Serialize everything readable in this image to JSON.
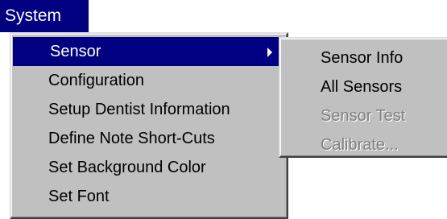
{
  "menubar": {
    "system_label": "System"
  },
  "main_menu": {
    "items": [
      {
        "label": "Sensor",
        "state": "selected",
        "has_submenu": true
      },
      {
        "label": "Configuration",
        "state": "enabled"
      },
      {
        "label": "Setup Dentist Information",
        "state": "enabled"
      },
      {
        "label": "Define Note Short-Cuts",
        "state": "enabled"
      },
      {
        "label": "Set Background Color",
        "state": "enabled"
      },
      {
        "label": "Set Font",
        "state": "enabled"
      }
    ]
  },
  "sub_menu": {
    "items": [
      {
        "label": "Sensor Info",
        "state": "enabled"
      },
      {
        "label": "All Sensors",
        "state": "enabled"
      },
      {
        "label": "Sensor Test",
        "state": "disabled"
      },
      {
        "label": "Calibrate...",
        "state": "disabled"
      }
    ]
  },
  "colors": {
    "menu_background": "#c0c0c0",
    "selection": "#000080",
    "disabled_text": "#808080"
  },
  "icons": {
    "submenu_indicator": "triangle-right-icon"
  }
}
